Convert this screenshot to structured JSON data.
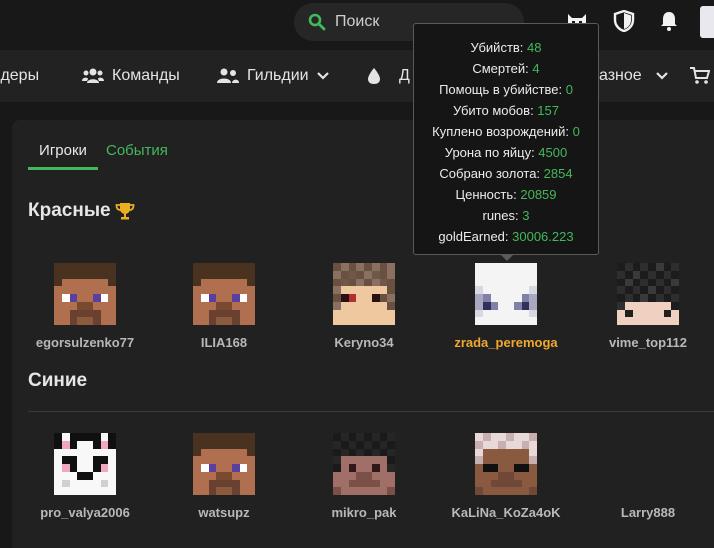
{
  "search": {
    "label": "Поиск"
  },
  "nav": {
    "leaders_partial": "Лидеры",
    "teams": "Команды",
    "guilds": "Гильдии",
    "d_partial": "Д",
    "misc_partial": "азное"
  },
  "tabs": {
    "players": "Игроки",
    "events": "События"
  },
  "teams": {
    "red": {
      "title": "Красные",
      "players": [
        "egorsulzenko77",
        "ILIA168",
        "Keryno34",
        "zrada_peremoga",
        "vime_top112"
      ]
    },
    "blue": {
      "title": "Синие",
      "players": [
        "pro_valya2006",
        "watsupz",
        "mikro_pak",
        "KaLiNa_KoZa4oK",
        "Larry888"
      ]
    }
  },
  "tooltip": {
    "rows": [
      {
        "label": "Убийств:",
        "value": "48"
      },
      {
        "label": "Смертей:",
        "value": "4"
      },
      {
        "label": "Помощь в убийстве:",
        "value": "0"
      },
      {
        "label": "Убито мобов:",
        "value": "157"
      },
      {
        "label": "Куплено возрождений:",
        "value": "0"
      },
      {
        "label": "Урона по яйцу:",
        "value": "4500"
      },
      {
        "label": "Собрано золота:",
        "value": "2854"
      },
      {
        "label": "Ценность:",
        "value": "20859"
      },
      {
        "label": "runes:",
        "value": "3"
      },
      {
        "label": "goldEarned:",
        "value": "30006.223"
      }
    ]
  },
  "colors": {
    "accent": "#43b85a",
    "highlight": "#f0a830",
    "trophy": "#e8b020"
  }
}
